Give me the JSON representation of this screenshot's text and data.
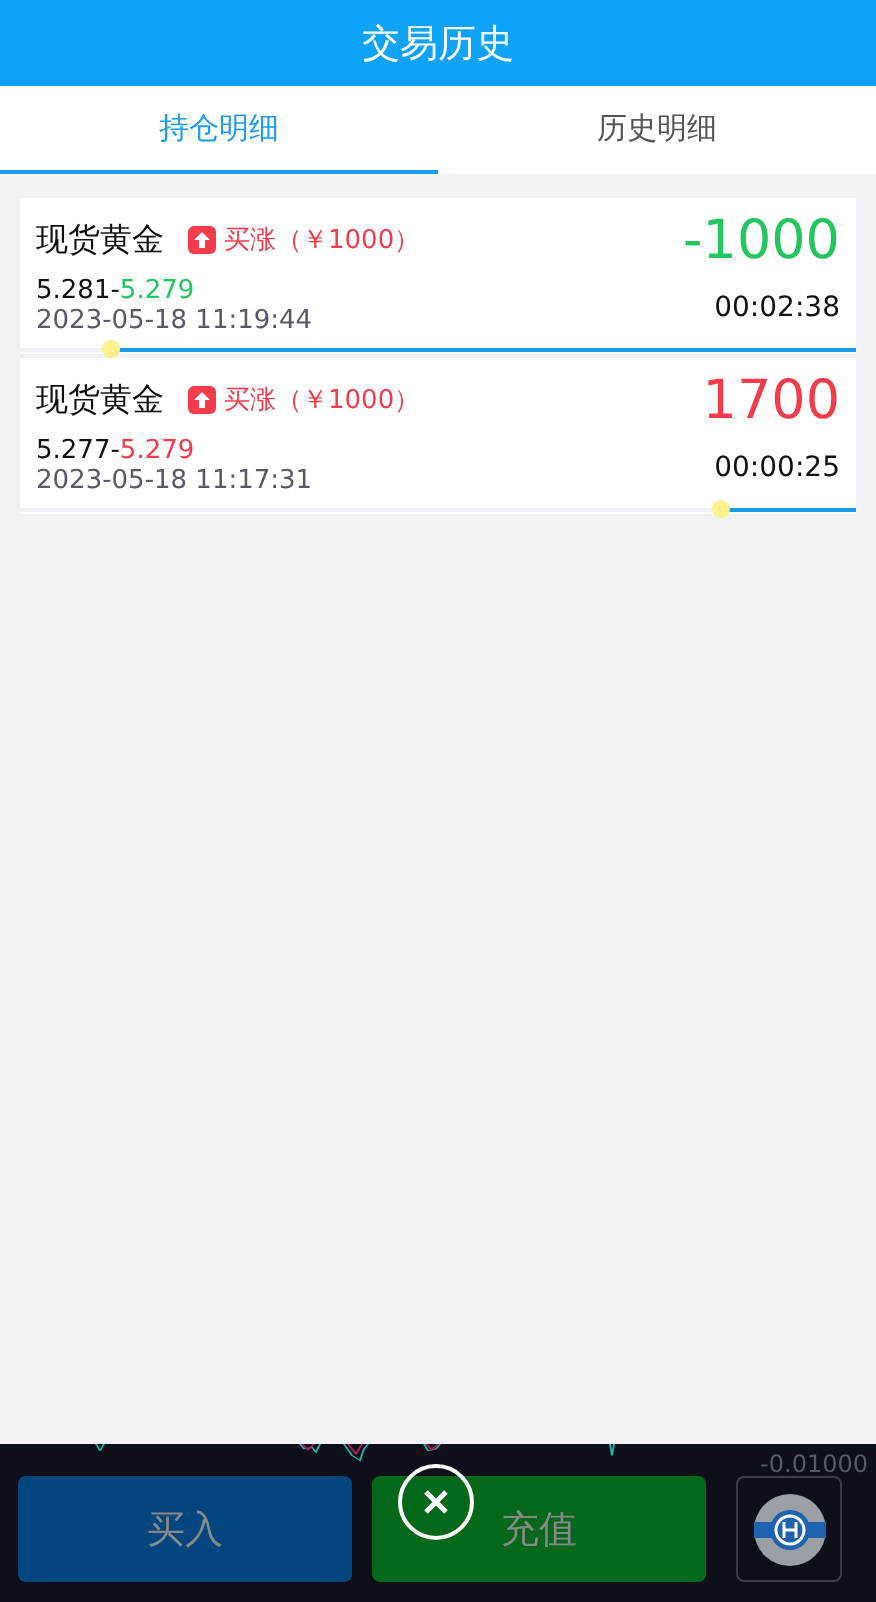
{
  "header": {
    "title": "交易历史"
  },
  "tabs": [
    {
      "label": "持仓明细",
      "selected": true
    },
    {
      "label": "历史明细",
      "selected": false
    }
  ],
  "orders": [
    {
      "name": "现货黄金",
      "direction": "买涨（￥1000）",
      "open_price": "5.281",
      "separator": "-",
      "close_price": "5.279",
      "time": "2023-05-18 11:19:44",
      "pnl": "-1000",
      "kind": "loss",
      "countdown": "00:02:38",
      "level": 0.89
    },
    {
      "name": "现货黄金",
      "direction": "买涨（￥1000）",
      "open_price": "5.277",
      "separator": "-",
      "close_price": "5.279",
      "time": "2023-05-18 11:17:31",
      "pnl": "1700",
      "kind": "profit",
      "countdown": "00:00:25",
      "level": 0.16
    }
  ],
  "bottom_bar": {
    "axis_value": "-0.01000",
    "buttons": [
      {
        "label": "买入",
        "kind": "buy"
      },
      {
        "label": "充值",
        "kind": "recharge"
      }
    ]
  }
}
